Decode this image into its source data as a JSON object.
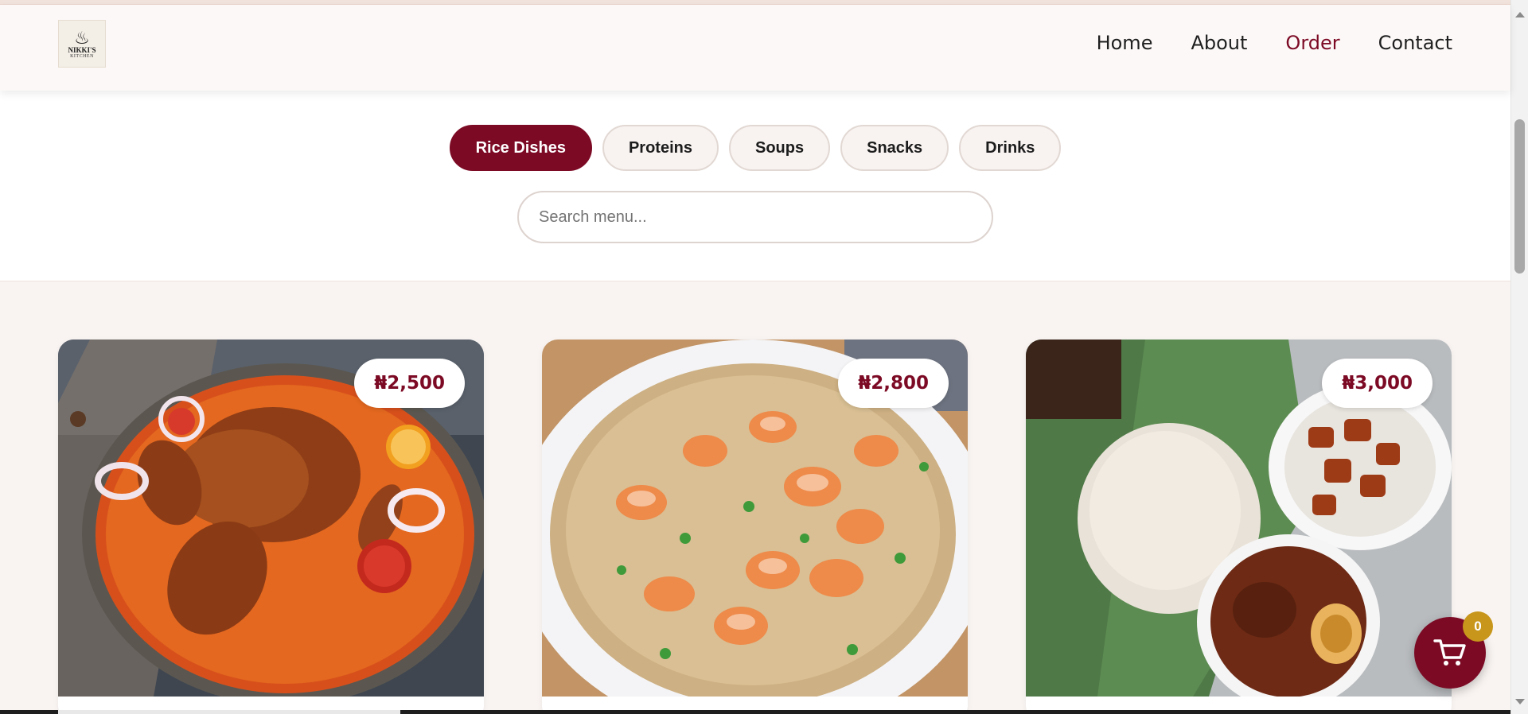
{
  "brand": {
    "logo_line1": "NIKKI'S",
    "logo_line2": "KITCHEN"
  },
  "nav": {
    "items": [
      {
        "label": "Home",
        "active": false
      },
      {
        "label": "About",
        "active": false
      },
      {
        "label": "Order",
        "active": true
      },
      {
        "label": "Contact",
        "active": false
      }
    ]
  },
  "categories": {
    "tabs": [
      {
        "label": "Rice Dishes",
        "active": true
      },
      {
        "label": "Proteins",
        "active": false
      },
      {
        "label": "Soups",
        "active": false
      },
      {
        "label": "Snacks",
        "active": false
      },
      {
        "label": "Drinks",
        "active": false
      }
    ]
  },
  "search": {
    "placeholder": "Search menu...",
    "value": ""
  },
  "menu": {
    "items": [
      {
        "price": "₦2,500",
        "image": "jollof-rice-with-roast-chicken"
      },
      {
        "price": "₦2,800",
        "image": "shrimp-fried-rice"
      },
      {
        "price": "₦3,000",
        "image": "ofada-rice-with-plantain-and-stew"
      }
    ]
  },
  "cart": {
    "count": "0",
    "icon": "shopping-cart-icon"
  },
  "colors": {
    "brand": "#7c0a25",
    "badge": "#c7961b",
    "background": "#f9f4f2"
  }
}
